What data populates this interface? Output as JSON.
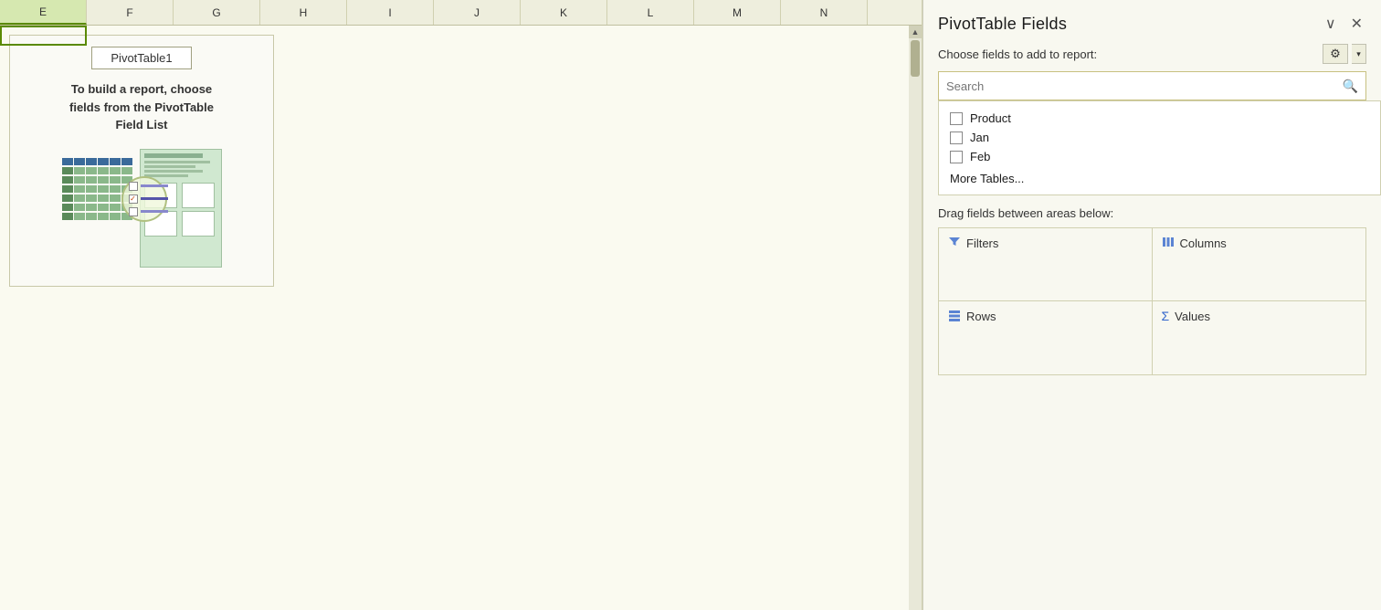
{
  "spreadsheet": {
    "columns": [
      {
        "id": "E",
        "width": 95,
        "active": true
      },
      {
        "id": "F",
        "width": 95,
        "active": false
      },
      {
        "id": "G",
        "width": 95,
        "active": false
      },
      {
        "id": "H",
        "width": 95,
        "active": false
      },
      {
        "id": "I",
        "width": 95,
        "active": false
      },
      {
        "id": "J",
        "width": 95,
        "active": false
      },
      {
        "id": "K",
        "width": 95,
        "active": false
      },
      {
        "id": "L",
        "width": 95,
        "active": false
      },
      {
        "id": "M",
        "width": 95,
        "active": false
      },
      {
        "id": "N",
        "width": 95,
        "active": false
      }
    ]
  },
  "pivot_placeholder": {
    "title": "PivotTable1",
    "instruction": "To build a report, choose\nfields from the PivotTable\nField List"
  },
  "panel": {
    "title": "PivotTable Fields",
    "subtitle": "Choose fields to add to report:",
    "search_placeholder": "Search",
    "chevron_symbol": "∨",
    "close_symbol": "✕",
    "gear_symbol": "⚙",
    "dropdown_symbol": "▾",
    "fields": [
      {
        "label": "Product",
        "checked": false
      },
      {
        "label": "Jan",
        "checked": false
      },
      {
        "label": "Feb",
        "checked": false
      }
    ],
    "more_tables_label": "More Tables...",
    "drag_title": "Drag fields between areas below:",
    "areas": [
      {
        "label": "Filters",
        "icon": "filter"
      },
      {
        "label": "Columns",
        "icon": "columns"
      },
      {
        "label": "Rows",
        "icon": "rows"
      },
      {
        "label": "Values",
        "icon": "sigma"
      }
    ]
  }
}
